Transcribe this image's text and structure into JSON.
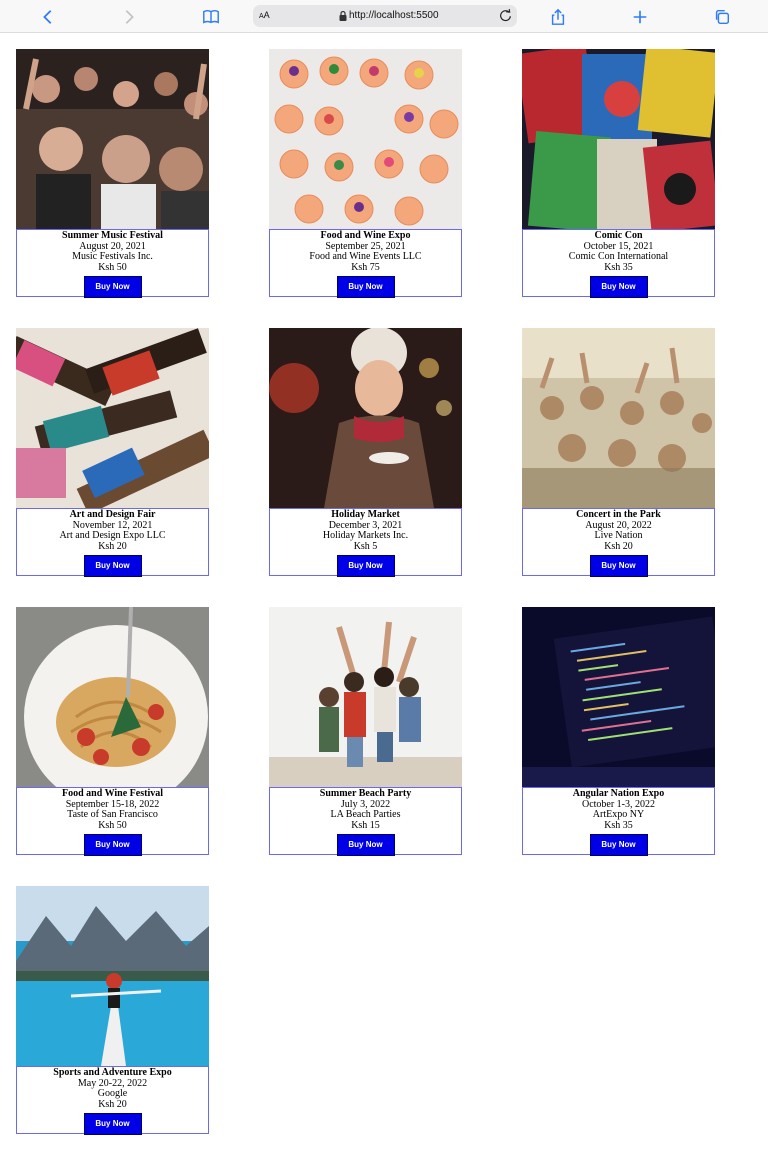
{
  "browser": {
    "text_size_label": "AA",
    "url": "http://localhost:5500"
  },
  "buy_label": "Buy Now",
  "events": [
    {
      "name": "Summer Music Festival",
      "date": "August 20, 2021",
      "organizer": "Music Festivals Inc.",
      "price": "Ksh 50",
      "image": "concert-crowd"
    },
    {
      "name": "Food and Wine Expo",
      "date": "September 25, 2021",
      "organizer": "Food and Wine Events LLC",
      "price": "Ksh 75",
      "image": "decorated-cookies"
    },
    {
      "name": "Comic Con",
      "date": "October 15, 2021",
      "organizer": "Comic Con International",
      "price": "Ksh 35",
      "image": "comic-books"
    },
    {
      "name": "Art and Design Fair",
      "date": "November 12, 2021",
      "organizer": "Art and Design Expo LLC",
      "price": "Ksh 20",
      "image": "paint-brushes"
    },
    {
      "name": "Holiday Market",
      "date": "December 3, 2021",
      "organizer": "Holiday Markets Inc.",
      "price": "Ksh 5",
      "image": "woman-winter-hat"
    },
    {
      "name": "Concert in the Park",
      "date": "August 20, 2022",
      "organizer": "Live Nation",
      "price": "Ksh 20",
      "image": "dancing-crowd"
    },
    {
      "name": "Food and Wine Festival",
      "date": "September 15-18, 2022",
      "organizer": "Taste of San Francisco",
      "price": "Ksh 50",
      "image": "spaghetti-plate"
    },
    {
      "name": "Summer Beach Party",
      "date": "July 3, 2022",
      "organizer": "LA Beach Parties",
      "price": "Ksh 15",
      "image": "friends-dancing"
    },
    {
      "name": "Angular Nation Expo",
      "date": "October 1-3, 2022",
      "organizer": "ArtExpo NY",
      "price": "Ksh 35",
      "image": "laptop-code"
    },
    {
      "name": "Sports and Adventure Expo",
      "date": "May 20-22, 2022",
      "organizer": "Google",
      "price": "Ksh 20",
      "image": "kayak-lake"
    }
  ]
}
